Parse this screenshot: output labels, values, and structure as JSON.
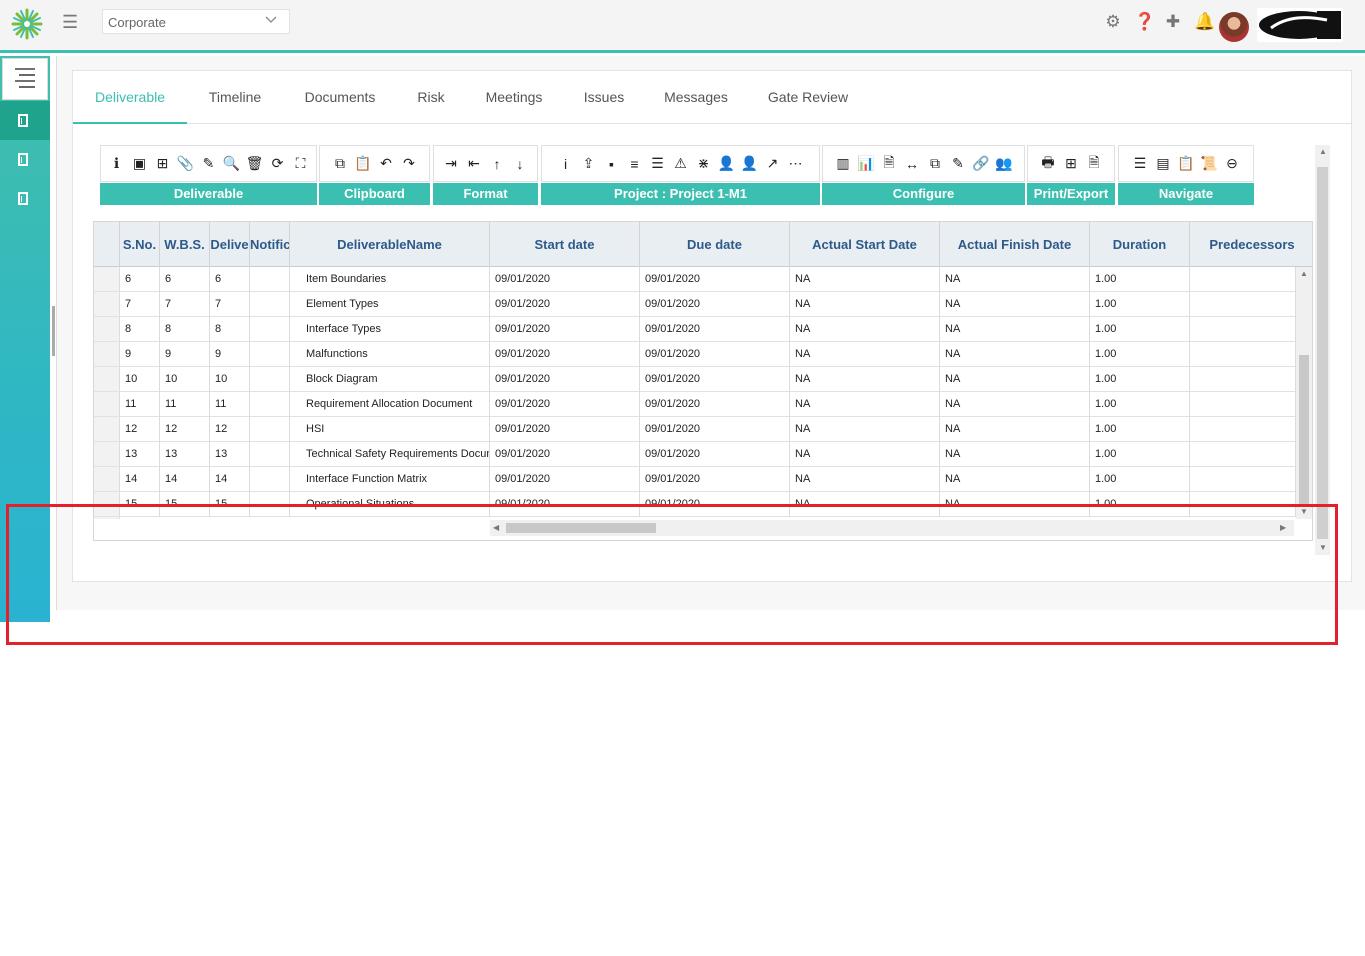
{
  "header": {
    "org_select": "Corporate",
    "icons": [
      "settings-icon",
      "help-icon",
      "add-icon",
      "bell-icon"
    ]
  },
  "tabs": [
    "Deliverable",
    "Timeline",
    "Documents",
    "Risk",
    "Meetings",
    "Issues",
    "Messages",
    "Gate Review"
  ],
  "ribbon": {
    "groups": [
      "Deliverable",
      "Clipboard",
      "Format",
      "Project : Project 1-M1",
      "Configure",
      "Print/Export",
      "Navigate"
    ]
  },
  "grid": {
    "columns": [
      "S.No.",
      "W.B.S.",
      "Delive",
      "Notific",
      "DeliverableName",
      "Start date",
      "Due date",
      "Actual Start Date",
      "Actual Finish Date",
      "Duration",
      "Predecessors"
    ],
    "rows": [
      [
        "6",
        "6",
        "6",
        "",
        "Item Boundaries",
        "09/01/2020",
        "09/01/2020",
        "NA",
        "NA",
        "1.00",
        ""
      ],
      [
        "7",
        "7",
        "7",
        "",
        "Element Types",
        "09/01/2020",
        "09/01/2020",
        "NA",
        "NA",
        "1.00",
        ""
      ],
      [
        "8",
        "8",
        "8",
        "",
        "Interface Types",
        "09/01/2020",
        "09/01/2020",
        "NA",
        "NA",
        "1.00",
        ""
      ],
      [
        "9",
        "9",
        "9",
        "",
        "Malfunctions",
        "09/01/2020",
        "09/01/2020",
        "NA",
        "NA",
        "1.00",
        ""
      ],
      [
        "10",
        "10",
        "10",
        "",
        "Block Diagram",
        "09/01/2020",
        "09/01/2020",
        "NA",
        "NA",
        "1.00",
        ""
      ],
      [
        "11",
        "11",
        "11",
        "",
        "Requirement Allocation Document",
        "09/01/2020",
        "09/01/2020",
        "NA",
        "NA",
        "1.00",
        ""
      ],
      [
        "12",
        "12",
        "12",
        "",
        "HSI",
        "09/01/2020",
        "09/01/2020",
        "NA",
        "NA",
        "1.00",
        ""
      ],
      [
        "13",
        "13",
        "13",
        "",
        "Technical Safety Requirements Docum",
        "09/01/2020",
        "09/01/2020",
        "NA",
        "NA",
        "1.00",
        ""
      ],
      [
        "14",
        "14",
        "14",
        "",
        "Interface Function Matrix",
        "09/01/2020",
        "09/01/2020",
        "NA",
        "NA",
        "1.00",
        ""
      ],
      [
        "15",
        "15",
        "15",
        "",
        "Operational Situations",
        "09/01/2020",
        "09/01/2020",
        "NA",
        "NA",
        "1.00",
        ""
      ]
    ]
  },
  "colors": {
    "accent": "#3bbfb0",
    "header_text": "#2d5a8a",
    "highlight": "#e2212c"
  }
}
